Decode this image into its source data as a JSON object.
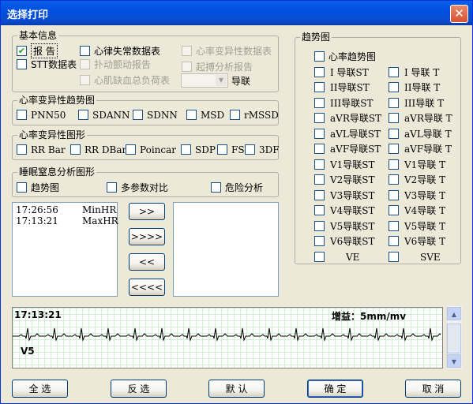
{
  "window": {
    "title": "选择打印",
    "close_glyph": "✕"
  },
  "basic_info": {
    "label": "基本信息",
    "report": "报  告",
    "arrhythmia_table": "心律失常数据表",
    "hrv_table": "心率变异性数据表",
    "stt_table": "STT数据表",
    "flutter_report": "扑动颤动报告",
    "pacing_report": "起搏分析报告",
    "ischemia_table": "心肌缺血总负荷表",
    "lead_label": "导联",
    "lead_value": ""
  },
  "hrv_trend": {
    "label": "心率变异性趋势图",
    "items": [
      "PNN50",
      "SDANN",
      "SDNN",
      "MSD",
      "rMSSD"
    ]
  },
  "hrv_graph": {
    "label": "心率变异性图形",
    "items": [
      "RR Bar",
      "RR DBar",
      "Poincar",
      "SDP",
      "FS",
      "3DF"
    ]
  },
  "apnea": {
    "label": "睡眠窒息分析图形",
    "items": [
      "趋势图",
      "多参数对比",
      "危险分析"
    ]
  },
  "list_left": [
    {
      "time": "17:26:56",
      "name": "MinHR"
    },
    {
      "time": "17:13:21",
      "name": "MaxHR"
    }
  ],
  "move_buttons": [
    ">>",
    ">>>>",
    "<<",
    "<<<<"
  ],
  "trend": {
    "label": "趋势图",
    "hr_trend": "心率趋势图",
    "rows": [
      [
        "I 导联ST",
        "I 导联 T"
      ],
      [
        "II导联ST",
        "II导联 T"
      ],
      [
        "III导联ST",
        "III导联 T"
      ],
      [
        "aVR导联ST",
        "aVR导联 T"
      ],
      [
        "aVL导联ST",
        "aVL导联 T"
      ],
      [
        "aVF导联ST",
        "aVF导联 T"
      ],
      [
        "V1导联ST",
        "V1导联 T"
      ],
      [
        "V2导联ST",
        "V2导联 T"
      ],
      [
        "V3导联ST",
        "V3导联 T"
      ],
      [
        "V4导联ST",
        "V4导联 T"
      ],
      [
        "V5导联ST",
        "V5导联 T"
      ],
      [
        "V6导联ST",
        "V6导联 T"
      ],
      [
        "VE",
        "SVE"
      ]
    ]
  },
  "ecg": {
    "time": "17:13:21",
    "gain": "增益：5mm/mv",
    "lead": "V5"
  },
  "footer": {
    "select_all": "全 选",
    "invert": "反 选",
    "default": "默 认",
    "ok": "确 定",
    "cancel": "取 消"
  },
  "checks": {
    "report": true
  },
  "colors": {
    "title_bar": "#0A5FE8",
    "close_btn": "#D55234",
    "grid": "#CFEFD3",
    "check_mark": "#21A121"
  },
  "icons": {
    "close": "close-icon",
    "check": "check-icon",
    "dropdown": "chevron-down-icon",
    "scroll_up": "arrow-up-icon",
    "scroll_down": "arrow-down-icon"
  }
}
